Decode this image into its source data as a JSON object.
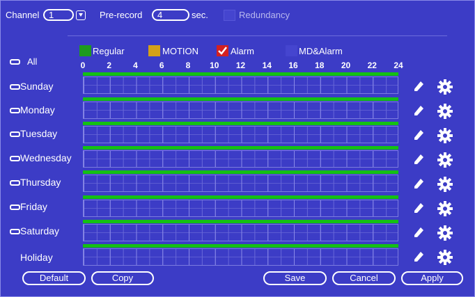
{
  "top": {
    "channel_label": "Channel",
    "channel_value": "1",
    "prerecord_label": "Pre-record",
    "prerecord_value": "4",
    "sec_label": "sec.",
    "redundancy_label": "Redundancy"
  },
  "legend": [
    {
      "label": "Regular",
      "color": "#1e9a1e"
    },
    {
      "label": "MOTION",
      "color": "#d4a018"
    },
    {
      "label": "Alarm",
      "color": "#d42020",
      "checked": true
    },
    {
      "label": "MD&Alarm",
      "color": "#4545cf"
    }
  ],
  "all_label": "All",
  "hours": [
    "0",
    "2",
    "4",
    "6",
    "8",
    "10",
    "12",
    "14",
    "16",
    "18",
    "20",
    "22",
    "24"
  ],
  "days": [
    {
      "label": "Sunday"
    },
    {
      "label": "Monday"
    },
    {
      "label": "Tuesday"
    },
    {
      "label": "Wednesday"
    },
    {
      "label": "Thursday"
    },
    {
      "label": "Friday"
    },
    {
      "label": "Saturday"
    },
    {
      "label": "Holiday"
    }
  ],
  "buttons": {
    "default": "Default",
    "copy": "Copy",
    "save": "Save",
    "cancel": "Cancel",
    "apply": "Apply"
  },
  "colors": {
    "background": "#3c3cc6",
    "schedule_bar": "#14c014"
  }
}
